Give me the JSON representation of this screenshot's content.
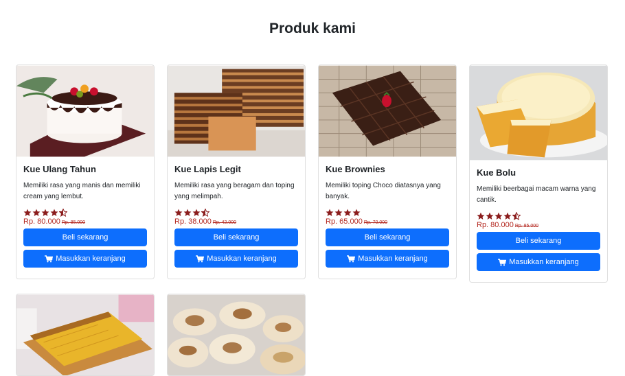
{
  "page": {
    "title": "Produk kami"
  },
  "colors": {
    "primary_button": "#0d6efd",
    "price": "#b3261e",
    "star": "#8b1d1d"
  },
  "products": [
    {
      "name": "Kue Ulang Tahun",
      "description": "Memiliki rasa yang manis dan memiliki cream yang lembut.",
      "rating": 4.5,
      "price": "Rp. 80.000",
      "old_price": "Rp. 85.000",
      "buy_label": "Beli sekarang",
      "cart_label": "Masukkan keranjang",
      "image": "cake-image"
    },
    {
      "name": "Kue Lapis Legit",
      "description": "Memiliki rasa yang beragam dan toping yang melimpah.",
      "rating": 3.5,
      "price": "Rp. 38.000",
      "old_price": "Rp. 42.000",
      "buy_label": "Beli sekarang",
      "cart_label": "Masukkan keranjang",
      "image": "layer-cake-image"
    },
    {
      "name": "Kue Brownies",
      "description": "Memiliki toping Choco diatasnya yang banyak.",
      "rating": 4,
      "price": "Rp. 65.000",
      "old_price": "Rp. 70.000",
      "buy_label": "Beli sekarang",
      "cart_label": "Masukkan keranjang",
      "image": "brownies-image"
    },
    {
      "name": "Kue Bolu",
      "description": "Memiliki beerbagai macam warna yang cantik.",
      "rating": 4.5,
      "price": "Rp. 80.000",
      "old_price": "Rp. 85.000",
      "buy_label": "Beli sekarang",
      "cart_label": "Masukkan keranjang",
      "image": "sponge-cake-image"
    }
  ],
  "partial_products": [
    {
      "image": "bika-ambon-image"
    },
    {
      "image": "bakpia-image"
    }
  ]
}
